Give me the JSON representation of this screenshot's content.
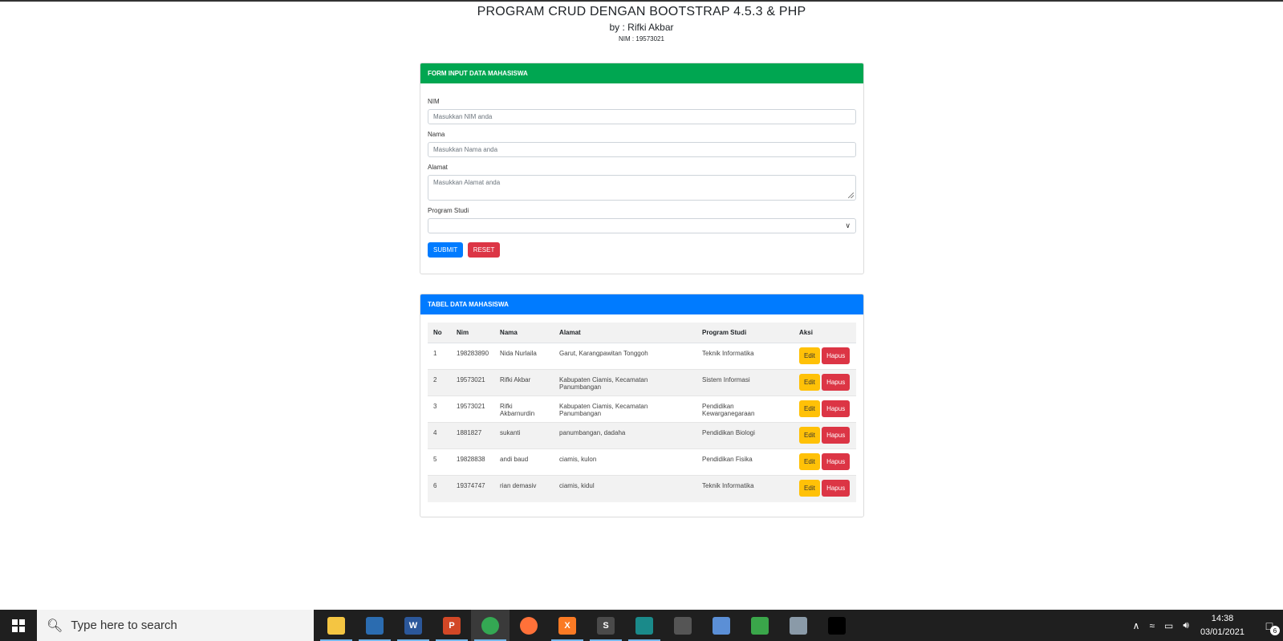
{
  "header": {
    "title": "PROGRAM CRUD DENGAN BOOTSTRAP 4.5.3 & PHP",
    "subtitle": "by : Rifki Akbar",
    "nim": "NIM : 19573021"
  },
  "form": {
    "header": "FORM INPUT DATA MAHASISWA",
    "nim_label": "NIM",
    "nim_placeholder": "Masukkan NIM anda",
    "nama_label": "Nama",
    "nama_placeholder": "Masukkan Nama anda",
    "alamat_label": "Alamat",
    "alamat_placeholder": "Masukkan Alamat anda",
    "prodi_label": "Program Studi",
    "prodi_value": "",
    "submit_label": "SUBMIT",
    "reset_label": "RESET",
    "accent_color": "#00a651"
  },
  "table": {
    "header": "TABEL DATA MAHASISWA",
    "columns": [
      "No",
      "Nim",
      "Nama",
      "Alamat",
      "Program Studi",
      "Aksi"
    ],
    "rows": [
      {
        "no": "1",
        "nim": "198283890",
        "nama": "Nida Nurlaila",
        "alamat": "Garut, Karangpawitan Tonggoh",
        "prodi": "Teknik Informatika"
      },
      {
        "no": "2",
        "nim": "19573021",
        "nama": "Rifki Akbar",
        "alamat": "Kabupaten Ciamis, Kecamatan Panumbangan",
        "prodi": "Sistem Informasi"
      },
      {
        "no": "3",
        "nim": "19573021",
        "nama": "Rifki Akbarnurdin",
        "alamat": "Kabupaten Ciamis, Kecamatan Panumbangan",
        "prodi": "Pendidikan Kewarganegaraan"
      },
      {
        "no": "4",
        "nim": "1881827",
        "nama": "sukanti",
        "alamat": "panumbangan, dadaha",
        "prodi": "Pendidikan Biologi"
      },
      {
        "no": "5",
        "nim": "19828838",
        "nama": "andi baud",
        "alamat": "ciamis, kulon",
        "prodi": "Pendidikan Fisika"
      },
      {
        "no": "6",
        "nim": "19374747",
        "nama": "rian demasiv",
        "alamat": "ciamis, kidul",
        "prodi": "Teknik Informatika"
      }
    ],
    "edit_label": "Edit",
    "hapus_label": "Hapus",
    "accent_color": "#007bff"
  },
  "taskbar": {
    "search_placeholder": "Type here to search",
    "time": "14:38",
    "date": "03/01/2021",
    "notification_count": "6",
    "apps": [
      {
        "name": "file-explorer-icon",
        "glyph": "",
        "color": "#f4c542"
      },
      {
        "name": "app-icon",
        "glyph": "",
        "color": "#2b6cb0"
      },
      {
        "name": "word-icon",
        "glyph": "W",
        "color": "#2b579a"
      },
      {
        "name": "powerpoint-icon",
        "glyph": "P",
        "color": "#d24726"
      },
      {
        "name": "chrome-icon",
        "glyph": "",
        "color": "#34a853"
      },
      {
        "name": "firefox-icon",
        "glyph": "",
        "color": "#ff7139"
      },
      {
        "name": "xampp-icon",
        "glyph": "X",
        "color": "#fb7a24"
      },
      {
        "name": "sublime-text-icon",
        "glyph": "S",
        "color": "#4a4a4a"
      },
      {
        "name": "media-player-icon",
        "glyph": "",
        "color": "#1a8a8a"
      },
      {
        "name": "app-icon",
        "glyph": "",
        "color": "#555555"
      },
      {
        "name": "virtualbox-icon",
        "glyph": "",
        "color": "#5b8fd6"
      },
      {
        "name": "network-app-icon",
        "glyph": "",
        "color": "#3aa64a"
      },
      {
        "name": "app-icon",
        "glyph": "",
        "color": "#8a9aa8"
      },
      {
        "name": "terminal-icon",
        "glyph": "",
        "color": "#000000"
      }
    ]
  }
}
